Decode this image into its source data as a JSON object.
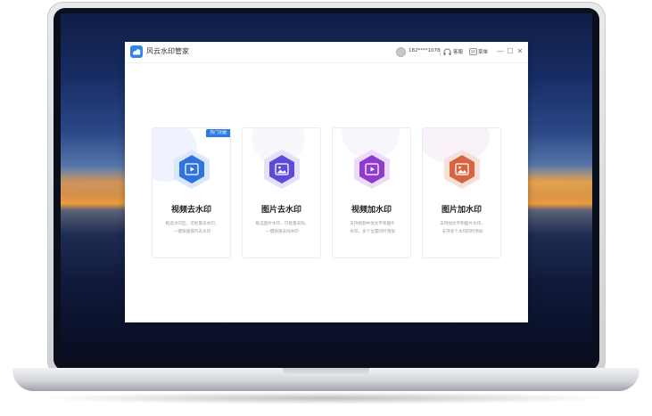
{
  "app": {
    "title": "风云水印管家",
    "user_phone": "182****1078",
    "service_label": "客服",
    "menu_label": "菜单",
    "minimize_symbol": "—",
    "maximize_symbol": "☐",
    "close_symbol": "✕"
  },
  "cards": [
    {
      "title": "视频去水印",
      "desc_line1": "框选水印区，可批量去水印，",
      "desc_line2": "一键快速操作去水印",
      "badge": "热门功能",
      "icon": "video-icon",
      "color": "#2f73e0"
    },
    {
      "title": "图片去水印",
      "desc_line1": "框选图片水印，可批量去除，",
      "desc_line2": "一键快速去除水印",
      "icon": "image-icon",
      "color": "#5b4bd8"
    },
    {
      "title": "视频加水印",
      "desc_line1": "支持视频中加文字和图片",
      "desc_line2": "水印，多个位置同时添加",
      "icon": "video-icon",
      "color": "#8d3bd0"
    },
    {
      "title": "图片加水印",
      "desc_line1": "支持加文字和图片水印，",
      "desc_line2": "支持多个水印同时添加",
      "icon": "image-icon",
      "color": "#d66640"
    }
  ]
}
